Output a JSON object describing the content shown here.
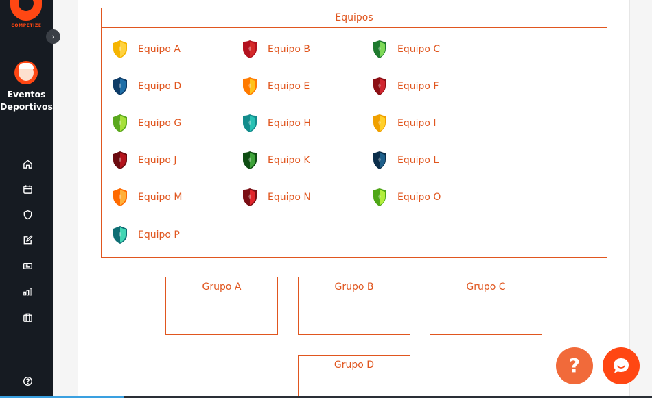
{
  "app": {
    "logo_text": "COMPETIZE",
    "org_name": "Eventos Deportivos"
  },
  "nav": [
    {
      "icon": "home-icon"
    },
    {
      "icon": "calendar-icon"
    },
    {
      "icon": "shield-icon"
    },
    {
      "icon": "edit-icon"
    },
    {
      "icon": "ticket-icon"
    },
    {
      "icon": "chart-icon"
    },
    {
      "icon": "briefcase-icon"
    },
    {
      "icon": "help-circle-icon"
    }
  ],
  "teams_box": {
    "title": "Equipos"
  },
  "teams": [
    {
      "name": "Equipo A",
      "colors": [
        "#f5b400",
        "#ffd23f"
      ]
    },
    {
      "name": "Equipo B",
      "colors": [
        "#b3121f",
        "#d42a2a"
      ]
    },
    {
      "name": "Equipo C",
      "colors": [
        "#1e7a2e",
        "#7ed957"
      ]
    },
    {
      "name": "Equipo D",
      "colors": [
        "#0d3b66",
        "#1f6fa8"
      ]
    },
    {
      "name": "Equipo E",
      "colors": [
        "#ff7a00",
        "#ffc21a"
      ]
    },
    {
      "name": "Equipo F",
      "colors": [
        "#8b0f14",
        "#d0262f"
      ]
    },
    {
      "name": "Equipo G",
      "colors": [
        "#5aa81e",
        "#a6e03a"
      ]
    },
    {
      "name": "Equipo H",
      "colors": [
        "#138c8c",
        "#28c2b4"
      ]
    },
    {
      "name": "Equipo I",
      "colors": [
        "#f0a000",
        "#ffd02a"
      ]
    },
    {
      "name": "Equipo J",
      "colors": [
        "#6b0b10",
        "#b3141c"
      ]
    },
    {
      "name": "Equipo K",
      "colors": [
        "#0e4d12",
        "#3fa33a"
      ]
    },
    {
      "name": "Equipo L",
      "colors": [
        "#0b2e4a",
        "#1e5f8a"
      ]
    },
    {
      "name": "Equipo M",
      "colors": [
        "#ff6a00",
        "#ffb03a"
      ]
    },
    {
      "name": "Equipo N",
      "colors": [
        "#7a0e14",
        "#e0262c"
      ]
    },
    {
      "name": "Equipo O",
      "colors": [
        "#4ea617",
        "#b2ee3c"
      ]
    },
    {
      "name": "Equipo P",
      "colors": [
        "#0e6e74",
        "#42d6b4"
      ]
    }
  ],
  "groups": [
    {
      "title": "Grupo A"
    },
    {
      "title": "Grupo B"
    },
    {
      "title": "Grupo C"
    },
    {
      "title": "Grupo D"
    }
  ],
  "help_button": {
    "label": "?"
  },
  "colors": {
    "accent": "#e0561f",
    "brand": "#ff4713",
    "sidebar": "#161b22"
  }
}
